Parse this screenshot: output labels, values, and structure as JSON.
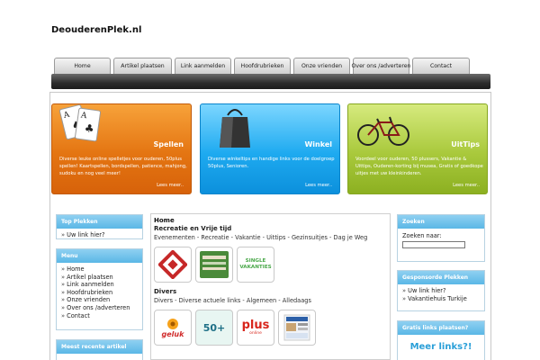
{
  "site": {
    "title": "DeouderenPlek.nl"
  },
  "nav": {
    "items": [
      "Home",
      "Artikel plaatsen",
      "Link aanmelden",
      "Hoofdrubrieken",
      "Onze vrienden",
      "Over ons /adverteren",
      "Contact"
    ]
  },
  "features": [
    {
      "title": "Spellen",
      "text": "Diverse leuke online spelletjes voor ouderen, 50plus spellen! Kaartspellen, bordspellen, patience, mahjong, sudoku en nog veel meer!",
      "more": "Lees meer..",
      "color": "#e47512"
    },
    {
      "title": "Winkel",
      "text": "Diverse winkeltips en handige links voor de doelgroep 50plus, Senioren.",
      "more": "Lees meer..",
      "color": "#1eaaf0"
    },
    {
      "title": "UitTips",
      "text": "Voordeel voor ouderen, 50 plussers, Vakantie & Uittips, Ouderen-korting bij musea, Gratis of goedkope uitjes met uw kleinkinderen.",
      "more": "Lees meer..",
      "color": "#a9c93c"
    }
  ],
  "left": {
    "top_plekken": {
      "title": "Top Plekken",
      "items": [
        "Uw link hier?"
      ]
    },
    "menu": {
      "title": "Menu",
      "items": [
        "Home",
        "Artikel plaatsen",
        "Link aanmelden",
        "Hoofdrubrieken",
        "Onze vrienden",
        "Over ons /adverteren",
        "Contact"
      ]
    },
    "recent": {
      "title": "Meest recente artikel"
    }
  },
  "main": {
    "home": "Home",
    "section1": {
      "title": "Recreatie en Vrije tijd",
      "links": "Evenementen - Recreatie - Vakantie - Uittips - Gezinsuitjes - Dag je Weg"
    },
    "section2": {
      "title": "Divers",
      "links": "Divers - Diverse actuele links - Algemeen - Alledaags"
    }
  },
  "thumbs": {
    "single_label": "SINGLE VAKANTIES",
    "geluk_label": "geluk",
    "fifty_label": "50+",
    "plus_label": "plus",
    "plus_sub": "online"
  },
  "right": {
    "zoeken": {
      "title": "Zoeken",
      "label": "Zoeken naar:"
    },
    "sponsored": {
      "title": "Gesponsorde Plekken",
      "items": [
        "Uw link hier?",
        "Vakantiehuis Turkije"
      ]
    },
    "free": {
      "title": "Gratis links plaatsen?",
      "banner": "Meer links?!"
    }
  },
  "colors": {
    "accent": "#5ab7e6",
    "navbar": "#2d2d2d"
  }
}
